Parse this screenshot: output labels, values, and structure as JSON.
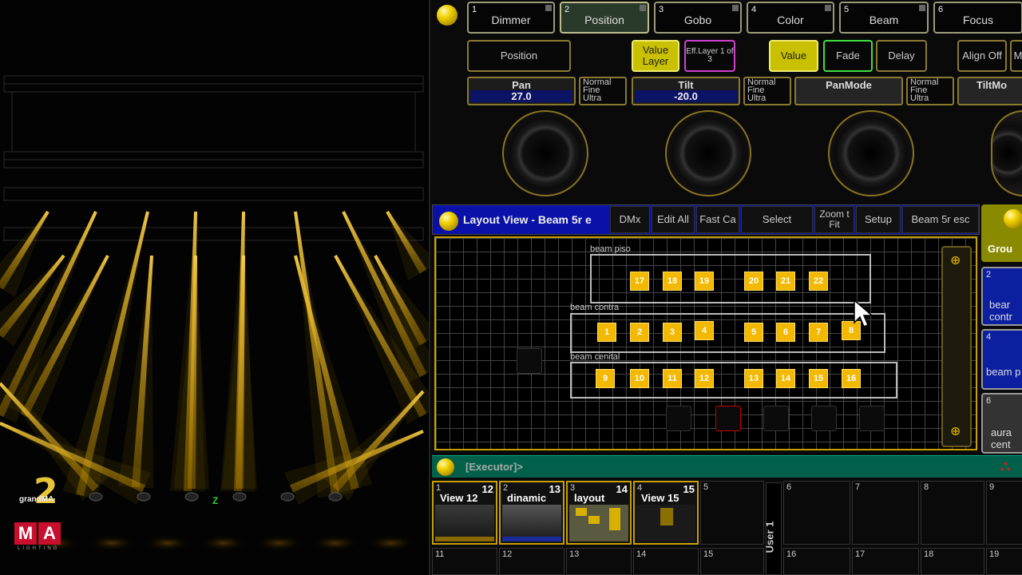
{
  "feature_tabs": [
    {
      "num": "1",
      "label": "Dimmer"
    },
    {
      "num": "2",
      "label": "Position"
    },
    {
      "num": "3",
      "label": "Gobo"
    },
    {
      "num": "4",
      "label": "Color"
    },
    {
      "num": "5",
      "label": "Beam"
    },
    {
      "num": "6",
      "label": "Focus"
    }
  ],
  "attribute_bar": {
    "position": "Position",
    "value_layer": "Value Layer",
    "eff_layer": "Eff.Layer 1 of 3",
    "value": "Value",
    "fade": "Fade",
    "delay": "Delay",
    "align_off": "Align Off",
    "more": "M"
  },
  "encoders": {
    "pan": {
      "title": "Pan",
      "value": "27.0"
    },
    "tilt": {
      "title": "Tilt",
      "value": "-20.0"
    },
    "panmode": {
      "title": "PanMode",
      "value": ""
    },
    "tiltmode": {
      "title": "TiltMo",
      "value": ""
    },
    "resolution_lines": [
      "Normal",
      "Fine",
      "Ultra"
    ]
  },
  "layout_view": {
    "title": "Layout View - Beam 5r e",
    "buttons": {
      "dmx": "DMx",
      "edit_all": "Edit All",
      "fast_ca": "Fast Ca",
      "select": "Select",
      "zoom_fit": "Zoom t Fit",
      "setup": "Setup",
      "beam_esc": "Beam 5r esc"
    },
    "groups": [
      {
        "label": "beam piso",
        "fixtures": [
          "17",
          "18",
          "19",
          "20",
          "21",
          "22"
        ]
      },
      {
        "label": "beam contra",
        "fixtures": [
          "1",
          "2",
          "3",
          "4",
          "5",
          "6",
          "7",
          "8"
        ]
      },
      {
        "label": "beam cenital",
        "fixtures": [
          "9",
          "10",
          "11",
          "12",
          "13",
          "14",
          "15",
          "16"
        ]
      }
    ]
  },
  "groups_panel": {
    "title": "Grou",
    "cells": [
      {
        "num": "2",
        "label": "bear contr"
      },
      {
        "num": "4",
        "label": "beam p"
      },
      {
        "num": "6",
        "label": "aura cent"
      }
    ]
  },
  "executor_bar": {
    "text": "[Executor]>"
  },
  "executors_row1": [
    {
      "num": "1",
      "label": "View 12",
      "tag": "12",
      "filled": true
    },
    {
      "num": "2",
      "label": "dinamic",
      "tag": "13",
      "filled": true
    },
    {
      "num": "3",
      "label": "layout",
      "tag": "14",
      "filled": true
    },
    {
      "num": "4",
      "label": "View 15",
      "tag": "15",
      "filled": true
    },
    {
      "num": "5",
      "label": "",
      "tag": "",
      "filled": false
    },
    {
      "num": "6",
      "label": "",
      "tag": "",
      "filled": false
    },
    {
      "num": "7",
      "label": "",
      "tag": "",
      "filled": false
    },
    {
      "num": "8",
      "label": "",
      "tag": "",
      "filled": false
    },
    {
      "num": "9",
      "label": "",
      "tag": "",
      "filled": false
    }
  ],
  "executors_row2": [
    "11",
    "12",
    "13",
    "14",
    "15",
    "16",
    "17",
    "18",
    "19"
  ],
  "user_label": "User 1",
  "visualizer": {
    "axis_label": "Z",
    "logo_number": "2",
    "logo_text": "grandMA",
    "logo_m": "M",
    "logo_a": "A",
    "logo_sub": "LIGHTING"
  },
  "colors": {
    "accent": "#c8a000",
    "beam": "#ffcc33",
    "fixture": "#f3b800",
    "title_bar": "#0a11a8",
    "executor_bar": "#00604a"
  }
}
